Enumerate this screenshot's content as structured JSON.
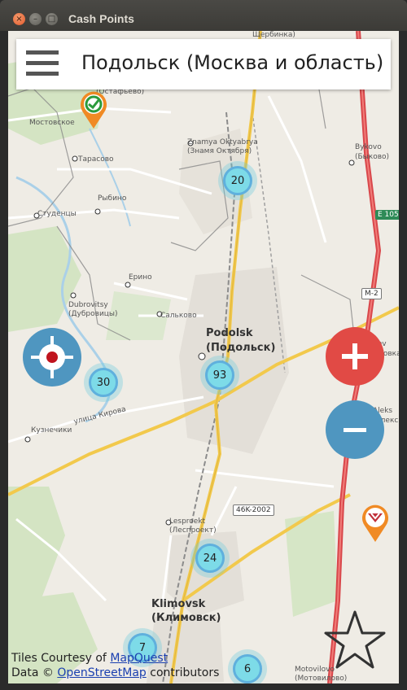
{
  "window": {
    "title": "Cash Points",
    "close_glyph": "×",
    "min_glyph": "–",
    "max_glyph": "□"
  },
  "topbar": {
    "menu_icon": "hamburger-icon",
    "city": "Подольск (Москва и область)"
  },
  "map_labels": {
    "top_partial": "Щербинка)",
    "ostafyevo": "(Остафьево)",
    "mostovskoe": "Мостовское",
    "znamya_en": "Znamya Oktyabrya",
    "znamya_ru": "(Знамя Октября)",
    "bykovo_en": "Bykovo",
    "bykovo_ru": "(Быково)",
    "tarasovo": "Тарасово",
    "rybino": "Рыбино",
    "studentsy": "Студенцы",
    "erino": "Ерино",
    "dubrovitsy_en": "Dubrovitsy",
    "dubrovitsy_ru": "(Дубровицы)",
    "salkovo": "Сальково",
    "podolsk_en": "Podolsk",
    "podolsk_ru": "(Подольск)",
    "kuznechiki": "Кузнечики",
    "kirova": "улица Кирова",
    "lesproekt_en": "Lesproekt",
    "lesproekt_ru": "(Леспроект)",
    "klimovsk_en": "Klimovsk",
    "klimovsk_ru": "(Климовск)",
    "motovilovo_en": "Motovilovo",
    "motovilovo_ru": "(Мотовилово)",
    "sev_partial": "Sev",
    "sev_partial2": "ыловка",
    "aleks_partial": "Aleks",
    "aleks_partial2": "(Алекс"
  },
  "road_shields": {
    "e105": "E 105",
    "m2": "M-2",
    "r46k": "46K-2002"
  },
  "clusters": [
    {
      "id": "north",
      "count": "20"
    },
    {
      "id": "podolsk",
      "count": "93"
    },
    {
      "id": "west",
      "count": "30"
    },
    {
      "id": "lesproekt",
      "count": "24"
    },
    {
      "id": "bottom-left",
      "count": "7"
    },
    {
      "id": "bottom-center",
      "count": "6"
    }
  ],
  "attribution": {
    "tiles_prefix": "Tiles Courtesy of ",
    "tiles_link": "MapQuest",
    "data_prefix": "Data © ",
    "data_link": "OpenStreetMap",
    "data_suffix": " contributors"
  },
  "icons": {
    "locate": "locate-crosshair-icon",
    "zoom_in": "plus-icon",
    "zoom_out": "minus-icon",
    "favorite": "star-outline-icon",
    "bank_pin_1": "sberbank-pin-icon",
    "bank_pin_2": "bank-logo-pin-icon"
  },
  "colors": {
    "zoom_in_bg": "#e14a45",
    "zoom_out_bg": "#4f96c0",
    "locate_bg": "#4f96c0",
    "cluster_fill": "#7ddbe8",
    "pin_orange": "#f08a24"
  }
}
